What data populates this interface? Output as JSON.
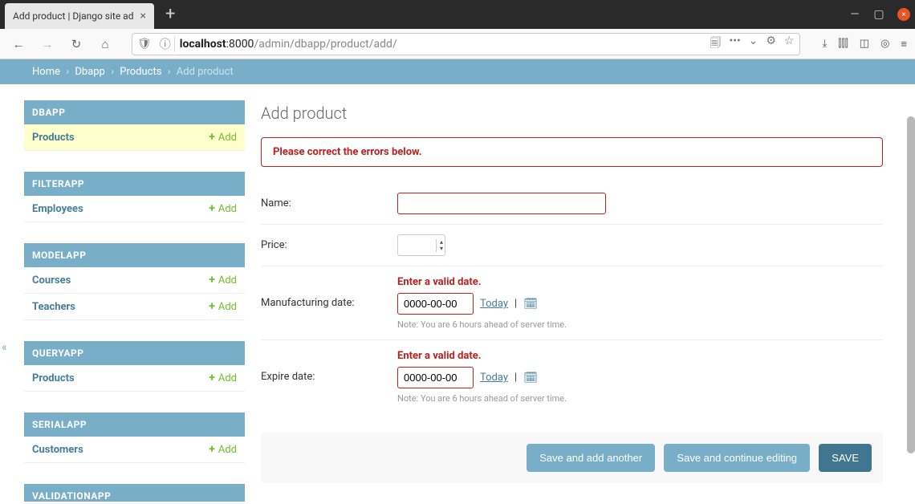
{
  "browser": {
    "tab_title": "Add product | Django site ad",
    "url_host": "localhost",
    "url_port": ":8000",
    "url_path": "/admin/dbapp/product/add/"
  },
  "breadcrumbs": {
    "home": "Home",
    "app": "Dbapp",
    "model": "Products",
    "current": "Add product"
  },
  "sidebar": {
    "collapse_icon": "«",
    "apps": [
      {
        "label": "DBAPP",
        "active": true,
        "models": [
          {
            "name": "Products",
            "active": true,
            "add_label": "Add"
          }
        ]
      },
      {
        "label": "FILTERAPP",
        "models": [
          {
            "name": "Employees",
            "add_label": "Add"
          }
        ]
      },
      {
        "label": "MODELAPP",
        "models": [
          {
            "name": "Courses",
            "add_label": "Add"
          },
          {
            "name": "Teachers",
            "add_label": "Add"
          }
        ]
      },
      {
        "label": "QUERYAPP",
        "models": [
          {
            "name": "Products",
            "add_label": "Add"
          }
        ]
      },
      {
        "label": "SERIALAPP",
        "models": [
          {
            "name": "Customers",
            "add_label": "Add"
          }
        ]
      },
      {
        "label": "VALIDATIONAPP",
        "models": []
      }
    ]
  },
  "main": {
    "title": "Add product",
    "errornote": "Please correct the errors below.",
    "fields": {
      "name": {
        "label": "Name:",
        "value": ""
      },
      "price": {
        "label": "Price:",
        "value": ""
      },
      "mfg": {
        "label": "Manufacturing date:",
        "error": "Enter a valid date.",
        "value": "0000-00-00",
        "today": "Today",
        "help": "Note: You are 6 hours ahead of server time."
      },
      "exp": {
        "label": "Expire date:",
        "error": "Enter a valid date.",
        "value": "0000-00-00",
        "today": "Today",
        "help": "Note: You are 6 hours ahead of server time."
      }
    },
    "buttons": {
      "save_add_another": "Save and add another",
      "save_continue": "Save and continue editing",
      "save": "SAVE"
    }
  }
}
